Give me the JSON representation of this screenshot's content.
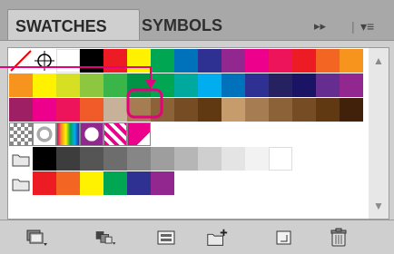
{
  "tabs": [
    {
      "label": "SWATCHES",
      "active": true
    },
    {
      "label": "SYMBOLS",
      "active": false
    }
  ],
  "panel_controls": {
    "collapse_glyph": "▸▸",
    "divider": "|",
    "menu_glyph": "▾≡"
  },
  "accent_color": "#e5007d",
  "swatch_rows": [
    [
      "none",
      "registration",
      "#ffffff",
      "#000000",
      "#ed1c24",
      "#fff200",
      "#00a651",
      "#0072bc",
      "#2e3192",
      "#92278f",
      "#ec008c",
      "#ed145b",
      "#ed1c24",
      "#f26522",
      "#f7941d"
    ],
    [
      "#f7941d",
      "#fff200",
      "#d7df23",
      "#8dc63f",
      "#39b54a",
      "#009444",
      "#00a651",
      "#00a99d",
      "#00aeef",
      "#0072bc",
      "#2e3192",
      "#262262",
      "#1b1464",
      "#662d91",
      "#92278f"
    ],
    [
      "#9e1f63",
      "#ec008c",
      "#ed145b",
      "#f15a29",
      "#c7b299",
      "#a67c52",
      "#8c6239",
      "#754c24",
      "#603913",
      "#c69c6d",
      "#a67c52",
      "#8c6239",
      "#754c24",
      "#603913",
      "#42210b"
    ],
    [
      "pattern",
      "pattern",
      "pattern",
      "pattern",
      "pattern",
      "pattern"
    ],
    [
      "folder",
      "#000000",
      "#3d3d3d",
      "#555555",
      "#6d6d6d",
      "#868686",
      "#9e9e9e",
      "#b6b6b6",
      "#cfcfcf",
      "#e4e4e4",
      "#f2f2f2",
      "#ffffff"
    ],
    [
      "folder",
      "#ed1c24",
      "#f26522",
      "#fff200",
      "#00a651",
      "#2e3192",
      "#92278f"
    ]
  ],
  "buttons": [
    {
      "name": "swatch-libraries-menu-button",
      "icon": "libraries-icon"
    },
    {
      "name": "show-swatch-kinds-button",
      "icon": "swatch-kinds-icon"
    },
    {
      "name": "swatch-options-button",
      "icon": "swatch-options-icon"
    },
    {
      "name": "new-color-group-button",
      "icon": "new-folder-icon"
    },
    {
      "name": "new-swatch-button",
      "icon": "new-swatch-icon"
    },
    {
      "name": "delete-swatch-button",
      "icon": "trash-icon"
    }
  ]
}
